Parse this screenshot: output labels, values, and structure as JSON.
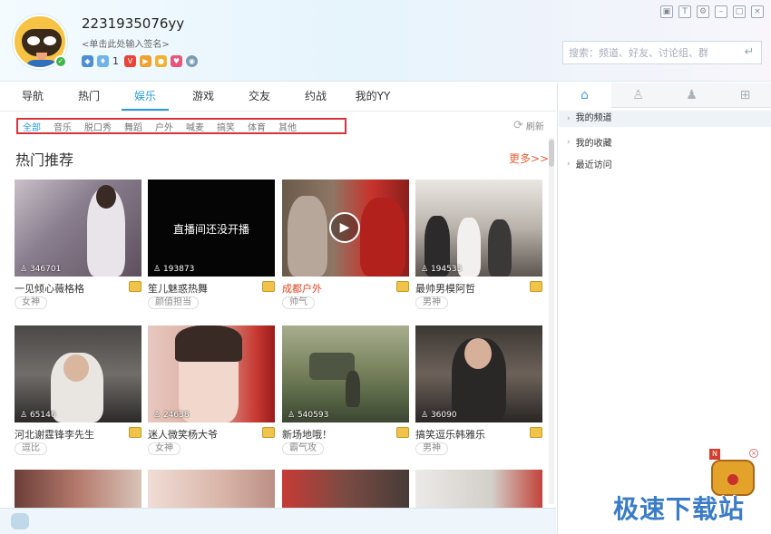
{
  "window": {
    "controls": [
      "skin-icon",
      "shirt-icon",
      "settings-icon",
      "minimize-icon",
      "maximize-icon",
      "close-icon"
    ]
  },
  "profile": {
    "username": "2231935076yy",
    "signature_placeholder": "<单击此处输入签名>",
    "badge_count": "1"
  },
  "search": {
    "placeholder": "搜索：频道、好友、讨论组、群"
  },
  "nav": {
    "tabs": [
      "导航",
      "热门",
      "娱乐",
      "游戏",
      "交友",
      "约战",
      "我的YY"
    ],
    "active_index": 2
  },
  "subcategories": {
    "items": [
      "全部",
      "音乐",
      "脱口秀",
      "舞蹈",
      "户外",
      "喊麦",
      "搞笑",
      "体育",
      "其他"
    ],
    "active_index": 0,
    "refresh_label": "刷新"
  },
  "section": {
    "title": "热门推荐",
    "more_label": "更多>>"
  },
  "cards": [
    {
      "title": "一见倾心薇格格",
      "tag": "女神",
      "viewers": "346701"
    },
    {
      "title": "笙儿魅惑热舞",
      "tag": "颜值担当",
      "viewers": "193873",
      "overlay_text": "直播间还没开播"
    },
    {
      "title": "成都户外",
      "tag": "帅气",
      "viewers": ""
    },
    {
      "title": "最帅男模阿哲",
      "tag": "男神",
      "viewers": "194535"
    },
    {
      "title": "河北谢霆锋李先生",
      "tag": "逗比",
      "viewers": "65146"
    },
    {
      "title": "迷人微笑杨大爷",
      "tag": "女神",
      "viewers": "24638"
    },
    {
      "title": "新场地哦！",
      "tag": "霸气攻",
      "viewers": "540593"
    },
    {
      "title": "搞笑逗乐韩雅乐",
      "tag": "男神",
      "viewers": "36090"
    }
  ],
  "right_panel": {
    "tabs": [
      "home-icon",
      "friend-icon",
      "group-icon",
      "apps-icon"
    ],
    "items": [
      "我的频道",
      "我的收藏",
      "最近访问"
    ]
  },
  "watermark": "极速下载站",
  "colors": {
    "accent": "#2b9bd8",
    "highlight_border": "#d9343d",
    "more_link": "#e8623a"
  }
}
